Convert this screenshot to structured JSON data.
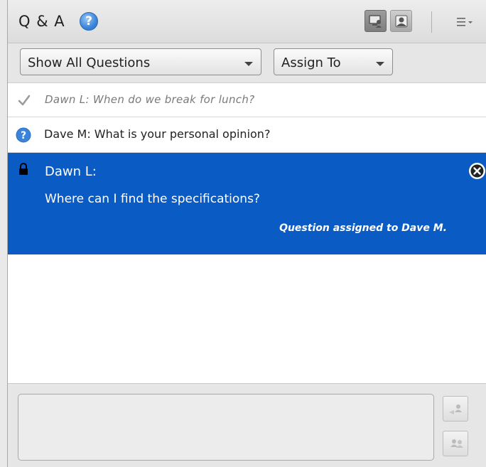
{
  "header": {
    "title": "Q & A",
    "help_icon": "help-icon",
    "help_glyph": "?",
    "presenter_view_icon": "presenter-view-icon",
    "participant_view_icon": "participant-view-icon",
    "menu_icon": "panel-menu-icon"
  },
  "filters": {
    "show_label": "Show All Questions",
    "assign_label": "Assign To"
  },
  "questions": [
    {
      "status": "answered",
      "status_icon": "checkmark-icon",
      "text": "Dawn L: When do we break for lunch?"
    },
    {
      "status": "open",
      "status_icon": "question-icon",
      "text": "Dave M: What is your personal opinion?"
    },
    {
      "status": "selected",
      "status_icon": "lock-icon",
      "author": "Dawn L:",
      "text": "Where can I find the specifications?",
      "assignment": "Question assigned to Dave M.",
      "close_icon": "close-circle-icon"
    }
  ],
  "compose": {
    "placeholder": "",
    "send_icon": "send-to-all-icon",
    "send_private_icon": "send-private-icon"
  },
  "colors": {
    "selected_row": "#0b5bc4",
    "help_blue": "#3b84d9",
    "panel_bg": "#e6e6e6"
  }
}
